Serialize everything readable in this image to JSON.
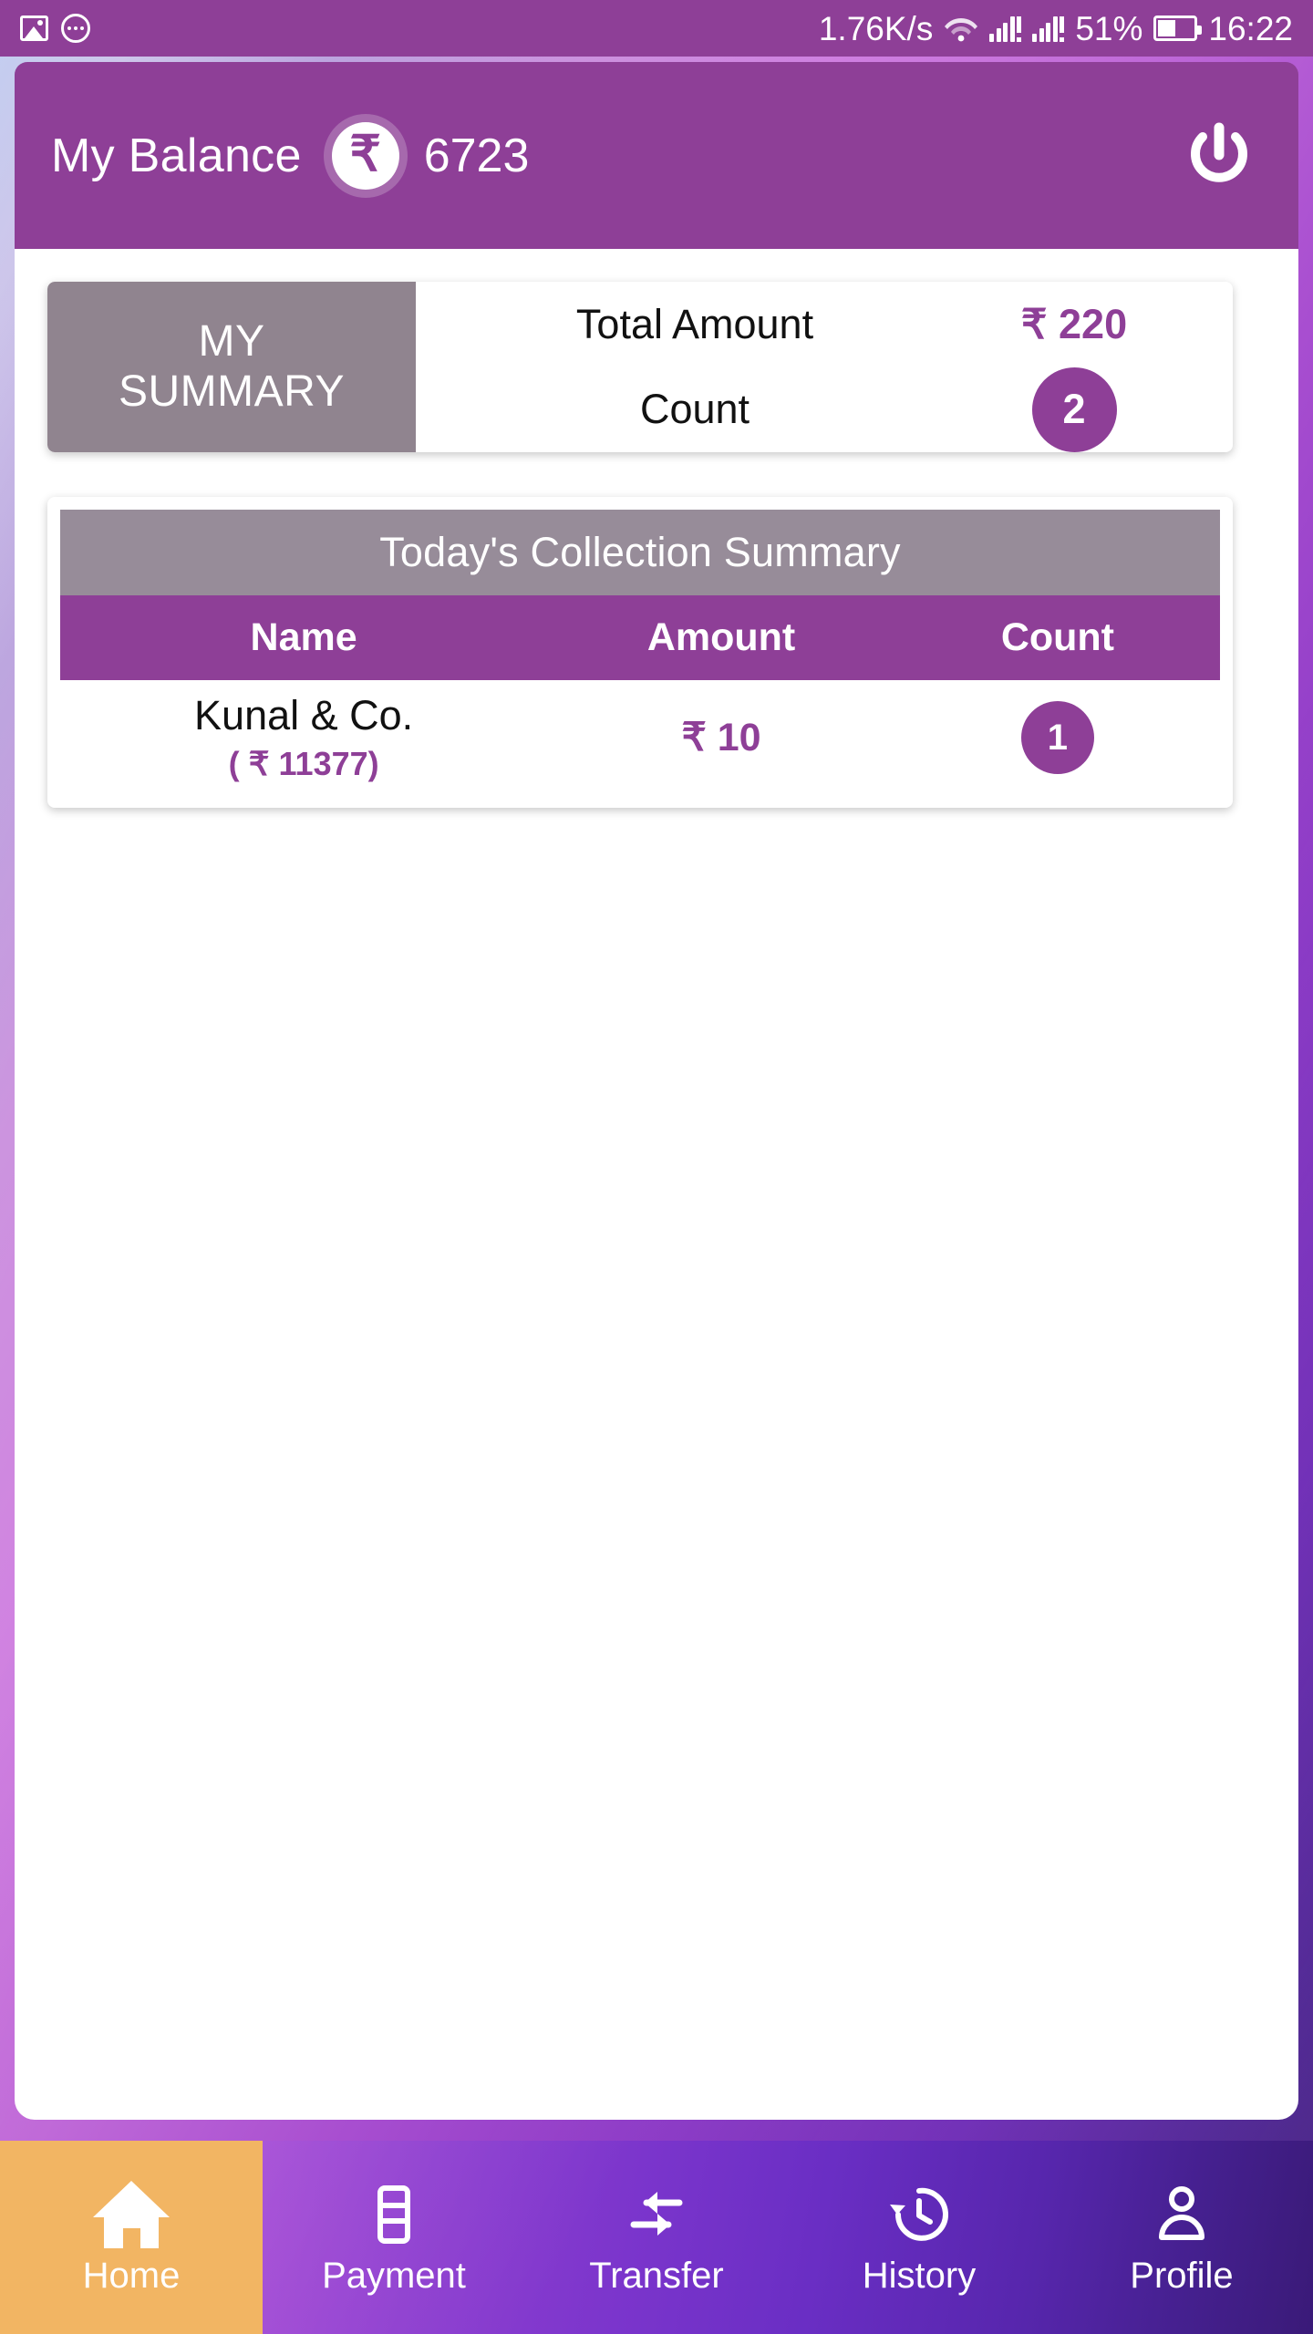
{
  "status_bar": {
    "left_icons": [
      "photo-icon",
      "more-options-icon"
    ],
    "network_speed": "1.76K/s",
    "right_icons": [
      "wifi-icon",
      "signal-1-icon",
      "signal-2-icon"
    ],
    "battery_percent": "51%",
    "clock": "16:22"
  },
  "header": {
    "title": "My Balance",
    "currency_symbol": "₹",
    "balance": "6723",
    "power_icon": "power-icon"
  },
  "summary": {
    "panel_label_line1": "MY",
    "panel_label_line2": "SUMMARY",
    "rows": [
      {
        "label": "Total Amount",
        "value": "₹ 220"
      },
      {
        "label": "Count",
        "value": "2"
      }
    ]
  },
  "collection": {
    "title": "Today's Collection Summary",
    "columns": [
      "Name",
      "Amount",
      "Count"
    ],
    "rows": [
      {
        "name": "Kunal & Co.",
        "sub": "( ₹ 11377)",
        "amount": "₹ 10",
        "count": "1"
      }
    ]
  },
  "bottom_nav": {
    "items": [
      {
        "label": "Home",
        "icon": "home-icon",
        "active": true
      },
      {
        "label": "Payment",
        "icon": "card-icon",
        "active": false
      },
      {
        "label": "Transfer",
        "icon": "transfer-icon",
        "active": false
      },
      {
        "label": "History",
        "icon": "history-icon",
        "active": false
      },
      {
        "label": "Profile",
        "icon": "person-icon",
        "active": false
      }
    ]
  },
  "colors": {
    "brand_purple": "#8e3f97",
    "muted_purple": "#90848f",
    "title_gray": "#978c99",
    "active_tab": "#f2b563"
  }
}
